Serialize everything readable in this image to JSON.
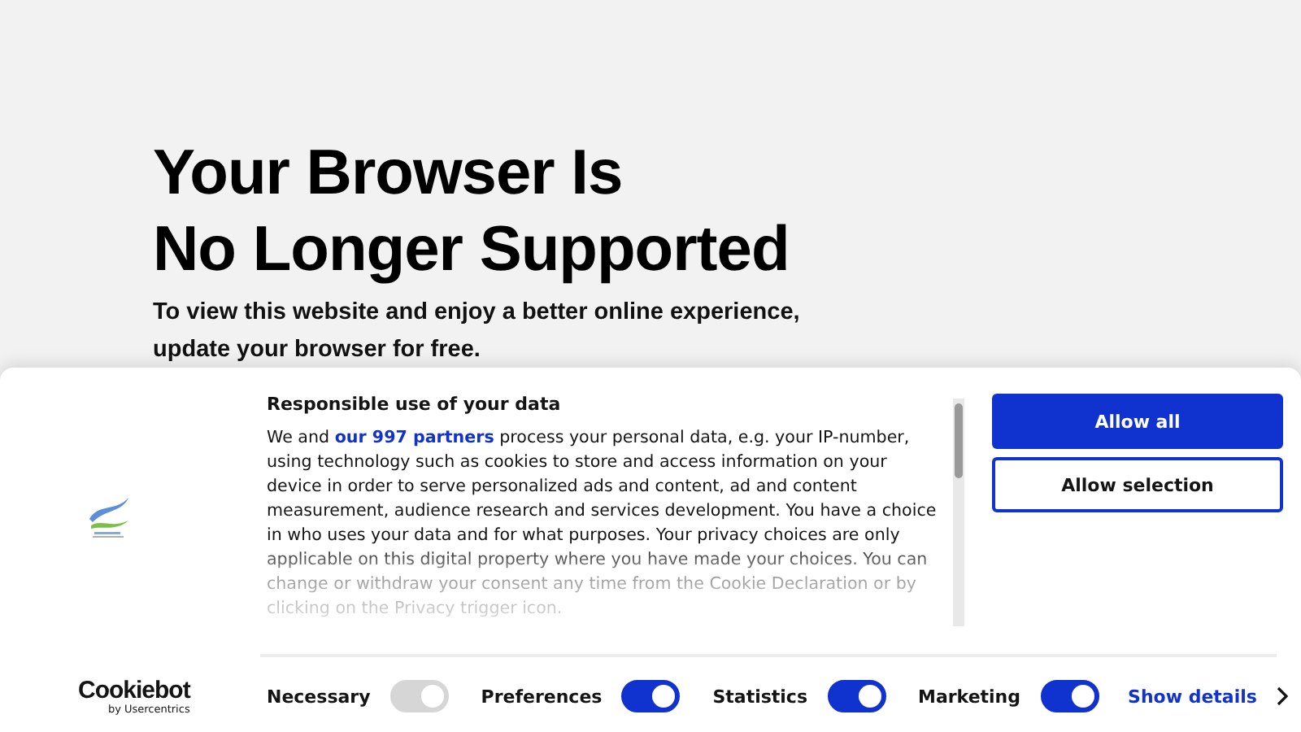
{
  "hero": {
    "title_lines": [
      "Your Browser Is",
      "No Longer Supported"
    ],
    "subtitle_lines": [
      "To view this website and enjoy a better online experience,",
      "update your browser for free."
    ]
  },
  "banner": {
    "heading": "Responsible use of your data",
    "body_before": "We and ",
    "body_link": "our 997 partners",
    "body_after": " process your personal data, e.g. your IP-number, using technology such as cookies to store and access information on your device in order to serve personalized ads and content, ad and content measurement, audience research and services development. You have a choice in who uses your data and for what purposes. Your privacy choices are only applicable on this digital property where you have made your choices. You can change or withdraw your consent any time from the Cookie Declaration or by clicking on the Privacy trigger icon.",
    "buttons": [
      {
        "label": "Allow all",
        "kind": "primary"
      },
      {
        "label": "Allow selection",
        "kind": "outline"
      }
    ],
    "brand": {
      "name": "Cookiebot",
      "byline": "by Usercentrics"
    },
    "toggles": [
      {
        "label": "Necessary",
        "on": true,
        "disabled": true
      },
      {
        "label": "Preferences",
        "on": true,
        "disabled": false
      },
      {
        "label": "Statistics",
        "on": true,
        "disabled": false
      },
      {
        "label": "Marketing",
        "on": true,
        "disabled": false
      }
    ],
    "details_link": "Show details"
  }
}
